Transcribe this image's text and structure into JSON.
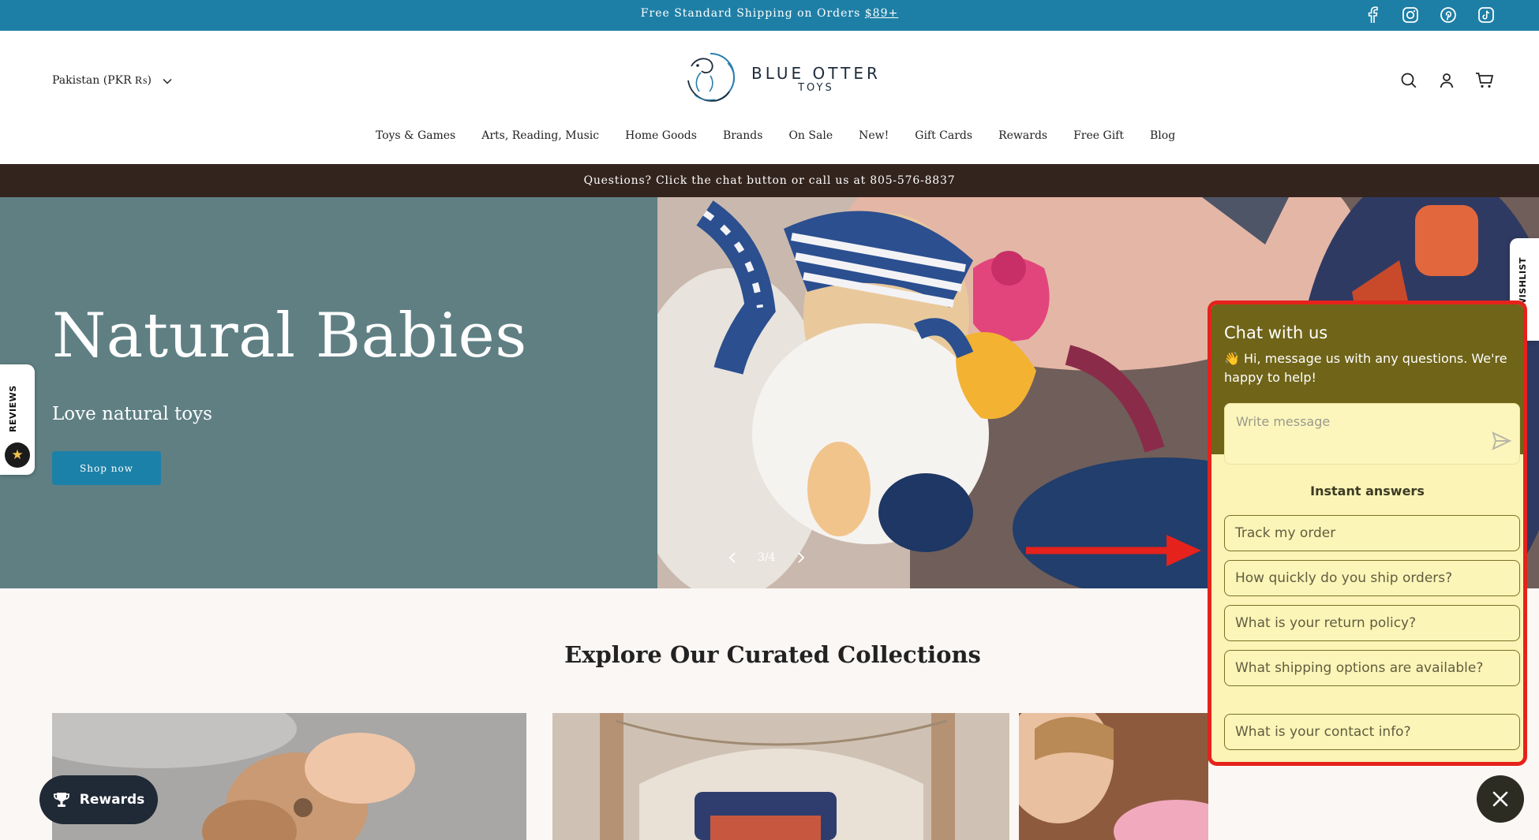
{
  "announcement": {
    "text": "Free Standard Shipping on Orders ",
    "link": "$89+",
    "social_icons": [
      "facebook-icon",
      "instagram-icon",
      "pinterest-icon",
      "tiktok-icon"
    ]
  },
  "header": {
    "country_selector": "Pakistan (PKR ₨)",
    "logo_line1": "BLUE OTTER",
    "logo_line2": "TOYS",
    "icons": [
      "search-icon",
      "account-icon",
      "cart-icon"
    ]
  },
  "nav": {
    "items": [
      "Toys & Games",
      "Arts, Reading, Music",
      "Home Goods",
      "Brands",
      "On Sale",
      "New!",
      "Gift Cards",
      "Rewards",
      "Free Gift",
      "Blog"
    ]
  },
  "notice": {
    "text": "Questions? Click the chat button or call us at 805-576-8837"
  },
  "hero": {
    "title": "Natural Babies",
    "subtitle": "Love natural toys",
    "button": "Shop now",
    "slide_counter": "3/4"
  },
  "side_tabs": {
    "reviews": "REVIEWS",
    "wishlist": "WISHLIST"
  },
  "collections": {
    "title": "Explore Our Curated Collections"
  },
  "chat": {
    "title": "Chat with us",
    "subtitle": "👋 Hi, message us with any questions. We're happy to help!",
    "input_placeholder": "Write message",
    "instant_heading": "Instant answers",
    "answers": [
      "Track my order",
      "How quickly do you ship orders?",
      "What is your return policy?",
      "What shipping options are available?",
      "What is your contact info?"
    ]
  },
  "rewards_button": "Rewards",
  "colors": {
    "announcement_bg": "#1e7fa6",
    "notice_bg": "#33241d",
    "hero_panel": "#5f7f83",
    "button_blue": "#1c81a8",
    "chat_header": "#6f6418",
    "chat_body": "#fbf4b6",
    "highlight_red": "#e5221c"
  }
}
